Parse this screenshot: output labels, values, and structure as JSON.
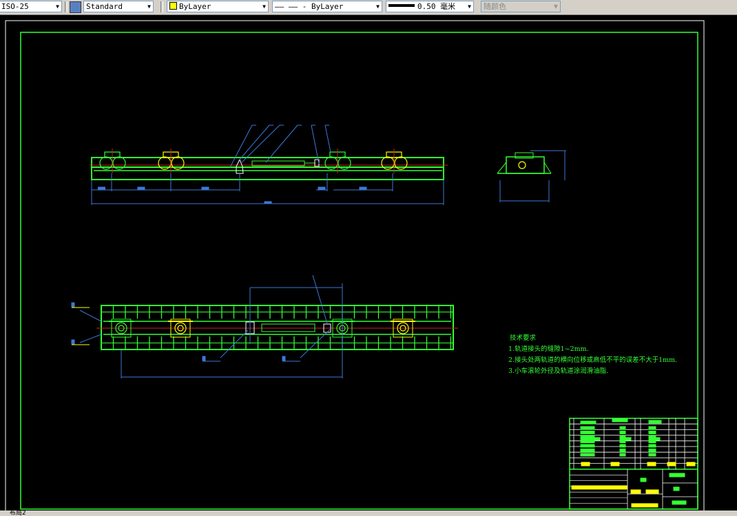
{
  "toolbar": {
    "dimstyle": "ISO-25",
    "textstyle": "Standard",
    "layer_color": "ByLayer",
    "linetype": "—— —— - ByLayer",
    "lineweight": "0.50 毫米",
    "plotstyle": "随颜色"
  },
  "tech_requirements": {
    "title": "技术要求",
    "items": [
      "1.轨道接头的缝隙1~2mm.",
      "2.接头处两轨道的横向位移或高低不平的误差不大于1mm.",
      "3.小车滚轮外径及轨道涂润滑油脂."
    ]
  },
  "layout_tab": "布局2",
  "colors": {
    "background": "#000000",
    "frame": "#33ff33",
    "dimension": "#3c78d8",
    "centerline": "#d02020",
    "highlight": "#ffff00"
  }
}
